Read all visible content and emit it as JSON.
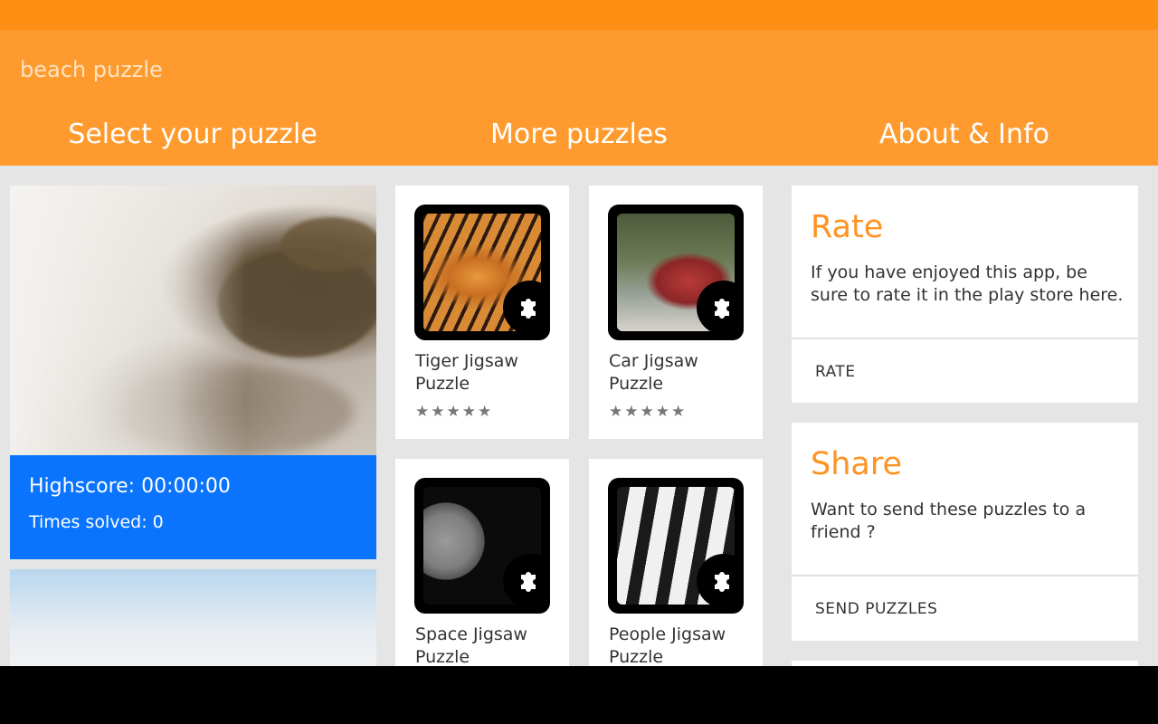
{
  "app": {
    "title": "beach puzzle"
  },
  "tabs": [
    {
      "label": "Select your puzzle"
    },
    {
      "label": "More puzzles"
    },
    {
      "label": "About & Info"
    }
  ],
  "puzzles": [
    {
      "highscore": "Highscore: 00:00:00",
      "times_solved": "Times solved: 0"
    }
  ],
  "more_puzzles": [
    {
      "name": "Tiger Jigsaw Puzzle",
      "stars": "★★★★★",
      "icon": "tiger-image"
    },
    {
      "name": "Car Jigsaw Puzzle",
      "stars": "★★★★★",
      "icon": "car-image"
    },
    {
      "name": "Space Jigsaw Puzzle",
      "stars": "★★★★★",
      "icon": "moon-image"
    },
    {
      "name": "People Jigsaw Puzzle",
      "stars": "★★★★★",
      "icon": "people-image"
    }
  ],
  "about": {
    "rate": {
      "title": "Rate",
      "text": "If you have enjoyed this app, be sure to rate it in the play store here.",
      "action": "RATE"
    },
    "share": {
      "title": "Share",
      "text": "Want to send these puzzles to a friend ?",
      "action": "SEND PUZZLES"
    }
  },
  "colors": {
    "status_bar": "#ff8f14",
    "app_bar": "#ff9a2e",
    "accent_title": "#ff9322",
    "score_panel": "#0a74ff",
    "background": "#e5e5e5"
  }
}
